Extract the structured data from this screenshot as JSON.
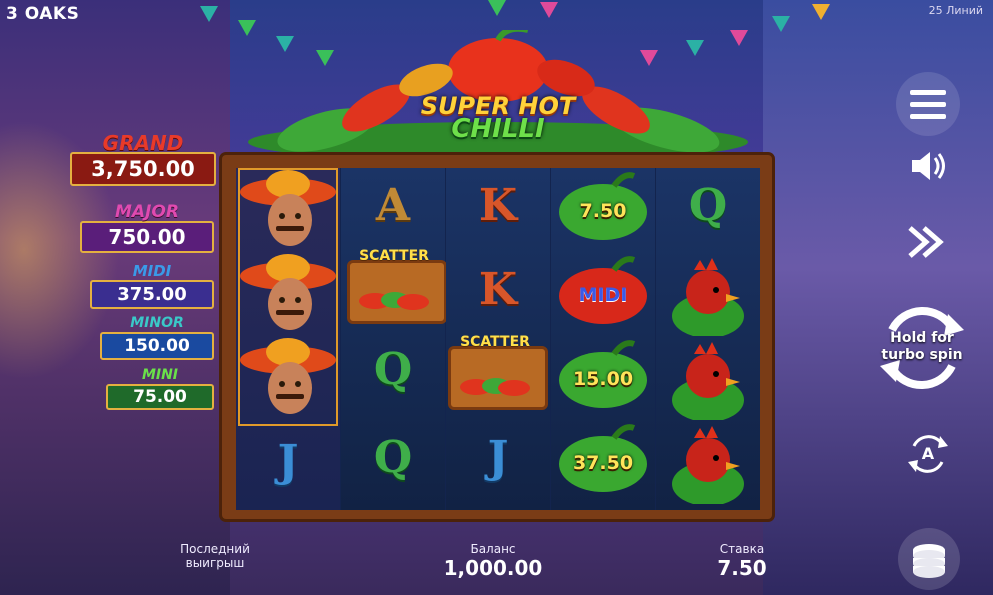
{
  "brand": "3 OAKS",
  "paylines": "25 Линий",
  "logo": {
    "line1": "SUPER HOT",
    "line2": "CHILLI"
  },
  "jackpots": [
    {
      "label": "GRAND",
      "value": "3,750.00",
      "label_color": "#e23a2a",
      "box_color": "#8a1a12"
    },
    {
      "label": "MAJOR",
      "value": "750.00",
      "label_color": "#d23aa8",
      "box_color": "#5a1e7a"
    },
    {
      "label": "MIDI",
      "value": "375.00",
      "label_color": "#2a8ee0",
      "box_color": "#3a2e90"
    },
    {
      "label": "MINOR",
      "value": "150.00",
      "label_color": "#2ac0c0",
      "box_color": "#1a4aa0"
    },
    {
      "label": "MINI",
      "value": "75.00",
      "label_color": "#5ed04a",
      "box_color": "#1f6a2a"
    }
  ],
  "reels": {
    "col1": [
      "mexican-man",
      "mexican-man",
      "mexican-man",
      "J"
    ],
    "col2": [
      "A",
      "SCATTER",
      "Q",
      "Q"
    ],
    "col3": [
      "K",
      "K",
      "SCATTER",
      "J"
    ],
    "col4": [
      "7.50",
      "MIDI",
      "15.00",
      "37.50"
    ],
    "col5": [
      "Q",
      "rooster",
      "rooster",
      "rooster"
    ],
    "scatter_label": "SCATTER"
  },
  "controls": {
    "menu_icon": "hamburger-icon",
    "sound_icon": "speaker-icon",
    "fast_icon": "fast-forward-icon",
    "spin_hint": "Hold for turbo spin",
    "autoplay_icon": "autoplay-icon",
    "autoplay_letter": "A",
    "bet_icon": "coins-icon"
  },
  "footer": {
    "last_win_label": "Последний выигрыш",
    "balance_label": "Баланс",
    "balance_value": "1,000.00",
    "bet_label": "Ставка",
    "bet_value": "7.50"
  }
}
